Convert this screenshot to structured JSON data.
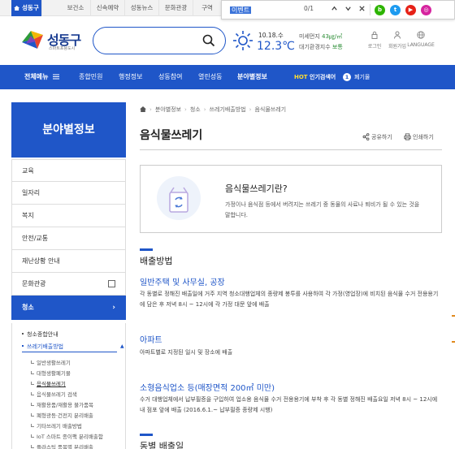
{
  "topbar": {
    "tabs": [
      "성동구청",
      "보건소",
      "신속예약",
      "성동뉴스",
      "문화관광",
      "구역"
    ]
  },
  "findbar": {
    "query": "이벤트",
    "count": "0/1"
  },
  "social": [
    {
      "name": "blog",
      "letter": "b",
      "color": "#2db400"
    },
    {
      "name": "twitter",
      "letter": "t",
      "color": "#1d9bf0"
    },
    {
      "name": "youtube",
      "letter": "▶",
      "color": "#e62117"
    },
    {
      "name": "instagram",
      "letter": "◎",
      "color": "#d6249f"
    }
  ],
  "header": {
    "logo_title": "성동구",
    "logo_sub": "스마트포용도시",
    "date": "10.18.수",
    "temperature": "12.3℃",
    "air_label": "미세먼지",
    "air_value": "43㎍/㎥",
    "air_quality_label": "대기환경지수",
    "air_quality_value": "보통",
    "util": [
      "로그인",
      "회원가입",
      "LANGUAGE"
    ]
  },
  "nav": {
    "all_menu": "전체메뉴",
    "items": [
      "종합민원",
      "행정정보",
      "성동참여",
      "열린성동",
      "분야별정보"
    ],
    "hot_label": "HOT",
    "hot_text": "인기검색어",
    "rank_no": "1",
    "rank_word": "폐기물"
  },
  "sidebar": {
    "title": "분야별정보",
    "items": [
      "교육",
      "일자리",
      "복지",
      "안전/교통",
      "재난상황 안내",
      "문화관광",
      "청소"
    ],
    "sub_l1": [
      "청소종합안내",
      "쓰레기배출방법"
    ],
    "sub_l2": [
      "일반생활쓰레기",
      "대형생활폐기물",
      "음식물쓰레기",
      "음식물쓰레기 검색",
      "재활용품/재활용 불가품목",
      "폐형광등·건전지 분리배출",
      "기타쓰레기 배출방법",
      "IoT 스마트 종이팩 분리배출함",
      "플라스틱 품목별 분리배출"
    ]
  },
  "breadcrumb": [
    "분야별정보",
    "청소",
    "쓰레기배출방법",
    "음식물쓰레기"
  ],
  "page": {
    "title": "음식물쓰레기",
    "share": "공유하기",
    "print": "인쇄하기"
  },
  "intro": {
    "title": "음식물쓰레기란?",
    "desc": "가정이나 음식점 등에서 버려지는 쓰레기 중 동물의 사료나 퇴비가 될 수 있는 것을 말합니다."
  },
  "section": {
    "title": "배출방법",
    "items": [
      {
        "title": "일반주택 및 사무실, 공장",
        "desc": "각 동별로 정해진 배출일에 거주 지역 청소대행업체의 종량제 봉투를 사용하여 각 가정(영업장)에 비치된 음식물 수거 전용용기에 담은 후 저녁 8시 ~ 12시에 각 가정 대문 앞에 배출"
      },
      {
        "title": "아파트",
        "desc": "아파트별로 지정된 일시 및 장소에 배출"
      },
      {
        "title": "소형음식업소 등(매장면적 200㎡ 미만)",
        "desc": "수거 대행업체에서 납부필증을 구입하여 업소용 음식물 수거 전용용기에 부착 후 각 동별 정해진 배출요일 저녁 8시 ~ 12시에 내 점포 앞에 배출 (2016.6.1.~ 납부필증 종량제 시행)"
      }
    ],
    "next_title": "동별 배출일"
  }
}
